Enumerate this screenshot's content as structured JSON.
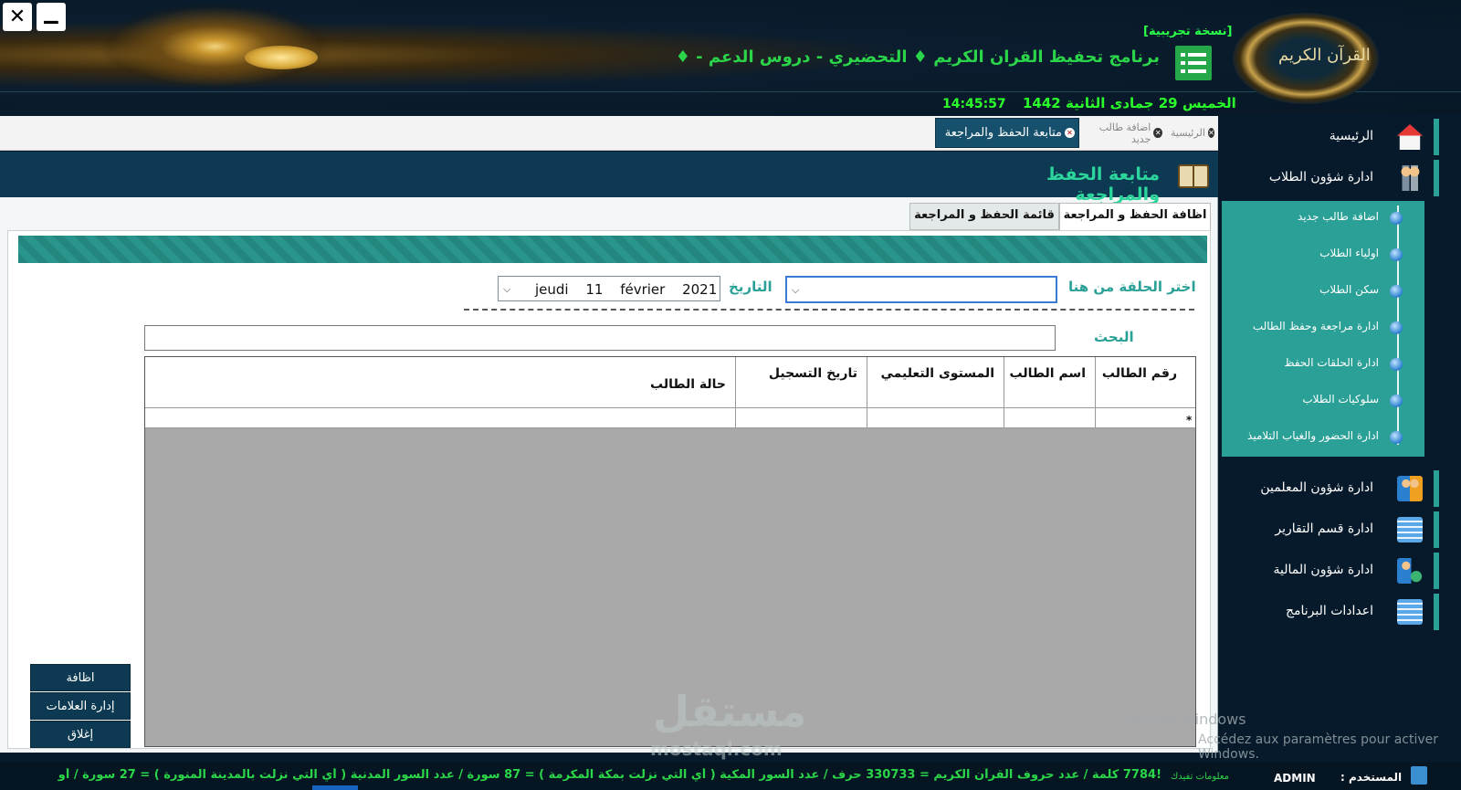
{
  "window": {
    "close_icon": "close-icon",
    "minimize_icon": "minimize-icon"
  },
  "header": {
    "trial_label": "[نسخة تجريبية]",
    "program_title": "برنامج تحفيظ القران الكريم ♦ التحضيري - دروس الدعم - ♦",
    "date_hijri": "الخميس 29 جمادى الثانية 1442",
    "clock": "14:45:57",
    "emblem_text": "القرآن الكريم"
  },
  "tabs": [
    {
      "label": "الرئيسية",
      "active": false
    },
    {
      "label": "اضافة طالب جديد",
      "active": false
    },
    {
      "label": "متابعة الحفظ والمراجعة",
      "active": true
    }
  ],
  "sidebar": {
    "items": [
      {
        "label": "الرئيسية",
        "icon": "home-icon"
      },
      {
        "label": "ادارة شؤون الطلاب",
        "icon": "students-icon"
      },
      {
        "label": "ادارة شؤون المعلمين",
        "icon": "teachers-icon"
      },
      {
        "label": "ادارة قسم التقارير",
        "icon": "reports-icon"
      },
      {
        "label": "ادارة شؤون المالية",
        "icon": "finance-icon"
      },
      {
        "label": "اعدادات البرنامج",
        "icon": "settings-icon"
      }
    ],
    "submenu": [
      "اضافة طالب جديد",
      "اولياء الطلاب",
      "سكن الطلاب",
      "ادارة مراجعة وحفظ الطالب",
      "ادارة الحلقات الحفظ",
      "سلوكيات الطلاب",
      "ادارة الحضور والغياب التلاميذ"
    ]
  },
  "panel": {
    "title": "متابعة الحفظ والمراجعة",
    "subtabs": [
      "اظافة الحفظ و المراجعة",
      "قائمة الحفظ و المراجعة"
    ],
    "circle_label": "اختر الحلقة من هنا",
    "date_label": "التاريخ",
    "date_value": "jeudi  11  février  2021",
    "search_label": "البحث",
    "grid_headers": [
      "رقم الطالب",
      "اسم الطالب",
      "المستوى التعليمي",
      "تاريخ التسجيل",
      "حالة الطالب"
    ],
    "new_row_marker": "*"
  },
  "actions": {
    "add": "اظافة",
    "marks": "إدارة العلامات",
    "close": "إغلاق"
  },
  "status": {
    "marquee": "!7784 كلمة / عدد حروف القرآن الكريم = 330733 حرف / عدد السور المكية ( أي التي نزلت بمكة المكرمة ) = 87 سورة / عدد السور المدنية ( أي التي نزلت بالمدينة المنورة ) = 27 سورة / أو",
    "info_label": "معلومات تفيدك",
    "user_label": "المستخدم :",
    "user_value": "ADMIN"
  },
  "watermark": {
    "logo": "مستقل",
    "site": "mostaql.com",
    "activate_1": "Activer Windows",
    "activate_2": "Accédez aux paramètres pour activer Windows."
  },
  "colors": {
    "accent_green": "#2bd54a",
    "teal": "#2aa097",
    "navy": "#0d3a52"
  }
}
